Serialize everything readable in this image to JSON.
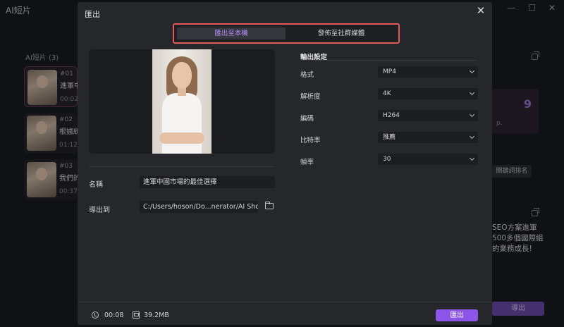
{
  "app": {
    "title": "AI短片"
  },
  "sidebar": {
    "count_label": "AI短片 (3)",
    "items": [
      {
        "num": "#01",
        "name": "進軍中",
        "duration": "00:02"
      },
      {
        "num": "#02",
        "name": "根據統",
        "duration": "01:12"
      },
      {
        "num": "#03",
        "name": "我們的",
        "duration": "00:37"
      }
    ]
  },
  "background": {
    "score": "9",
    "score_small": "p.",
    "rank_button": "關鍵詞排名",
    "text": "SEO方案進軍\n500多個國際組\n的業務成長!",
    "export_button": "導出"
  },
  "dialog": {
    "title": "匯出",
    "tabs": [
      {
        "label": "匯出至本機",
        "active": true
      },
      {
        "label": "發佈至社群媒體",
        "active": false
      }
    ],
    "name_label": "名稱",
    "name_value": "進軍中國市場的最佳選擇",
    "export_to_label": "導出到",
    "export_path": "C:/Users/hoson/Do...nerator/AI Shorts",
    "settings": {
      "heading": "輸出設定",
      "rows": [
        {
          "label": "格式",
          "value": "MP4"
        },
        {
          "label": "解析度",
          "value": "4K"
        },
        {
          "label": "編碼",
          "value": "H264"
        },
        {
          "label": "比特率",
          "value": "推薦"
        },
        {
          "label": "幀率",
          "value": "30"
        }
      ]
    },
    "footer": {
      "duration": "00:08",
      "size": "39.2MB",
      "export_button": "匯出"
    }
  },
  "colors": {
    "accent": "#8c55e8",
    "highlight": "#e05a5a"
  }
}
